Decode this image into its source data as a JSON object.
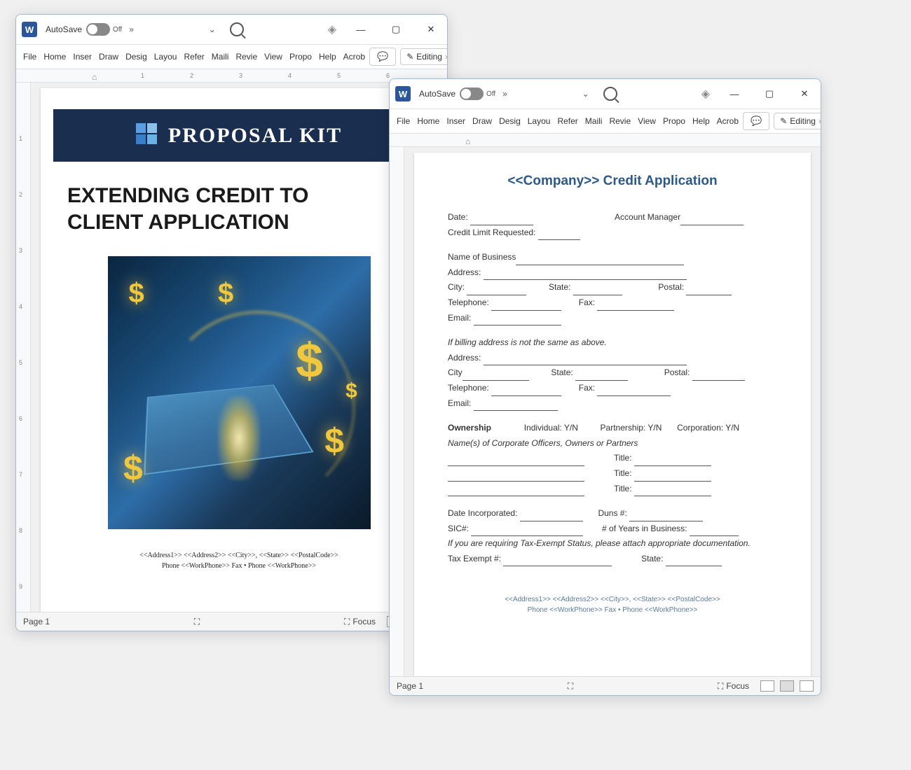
{
  "autosave": {
    "label": "AutoSave",
    "state": "Off"
  },
  "ribbon_tabs": [
    "File",
    "Home",
    "Inser",
    "Draw",
    "Desig",
    "Layou",
    "Refer",
    "Maili",
    "Revie",
    "View",
    "Propo",
    "Help",
    "Acrob"
  ],
  "editing_label": "Editing",
  "status": {
    "page": "Page 1",
    "focus": "Focus"
  },
  "doc1": {
    "logo_text": "PROPOSAL KIT",
    "title_line1": "EXTENDING CREDIT TO",
    "title_line2": "CLIENT APPLICATION",
    "footer_line1": "<<Address1>>  <<Address2>>  <<City>>, <<State>>  <<PostalCode>>",
    "footer_line2": "Phone <<WorkPhone>> Fax • Phone <<WorkPhone>>"
  },
  "doc2": {
    "title": "<<Company>> Credit Application",
    "date_label": "Date:",
    "account_manager_label": "Account Manager",
    "credit_limit_label": "Credit Limit Requested:",
    "name_business_label": "Name of Business",
    "address_label": "Address:",
    "city_label": "City:",
    "city_label_short": "City",
    "state_label": "State:",
    "postal_label": "Postal:",
    "telephone_label": "Telephone:",
    "fax_label": "Fax:",
    "email_label": "Email:",
    "billing_note": "If billing address is not the same as above.",
    "ownership_label": "Ownership",
    "individual": "Individual: Y/N",
    "partnership": "Partnership: Y/N",
    "corporation": "Corporation: Y/N",
    "officers_note": "Name(s) of Corporate Officers, Owners or Partners",
    "title_label": "Title:",
    "date_inc_label": "Date Incorporated:",
    "duns_label": "Duns #:",
    "sic_label": "SIC#:",
    "years_biz_label": "# of Years in Business:",
    "tax_exempt_note": "If you are requiring Tax-Exempt Status, please attach appropriate documentation.",
    "tax_exempt_num_label": "Tax Exempt #:",
    "state_label2": "State:",
    "footer_line1": "<<Address1>>  <<Address2>>  <<City>>, <<State>>  <<PostalCode>>",
    "footer_line2": "Phone <<WorkPhone>> Fax • Phone <<WorkPhone>>"
  }
}
